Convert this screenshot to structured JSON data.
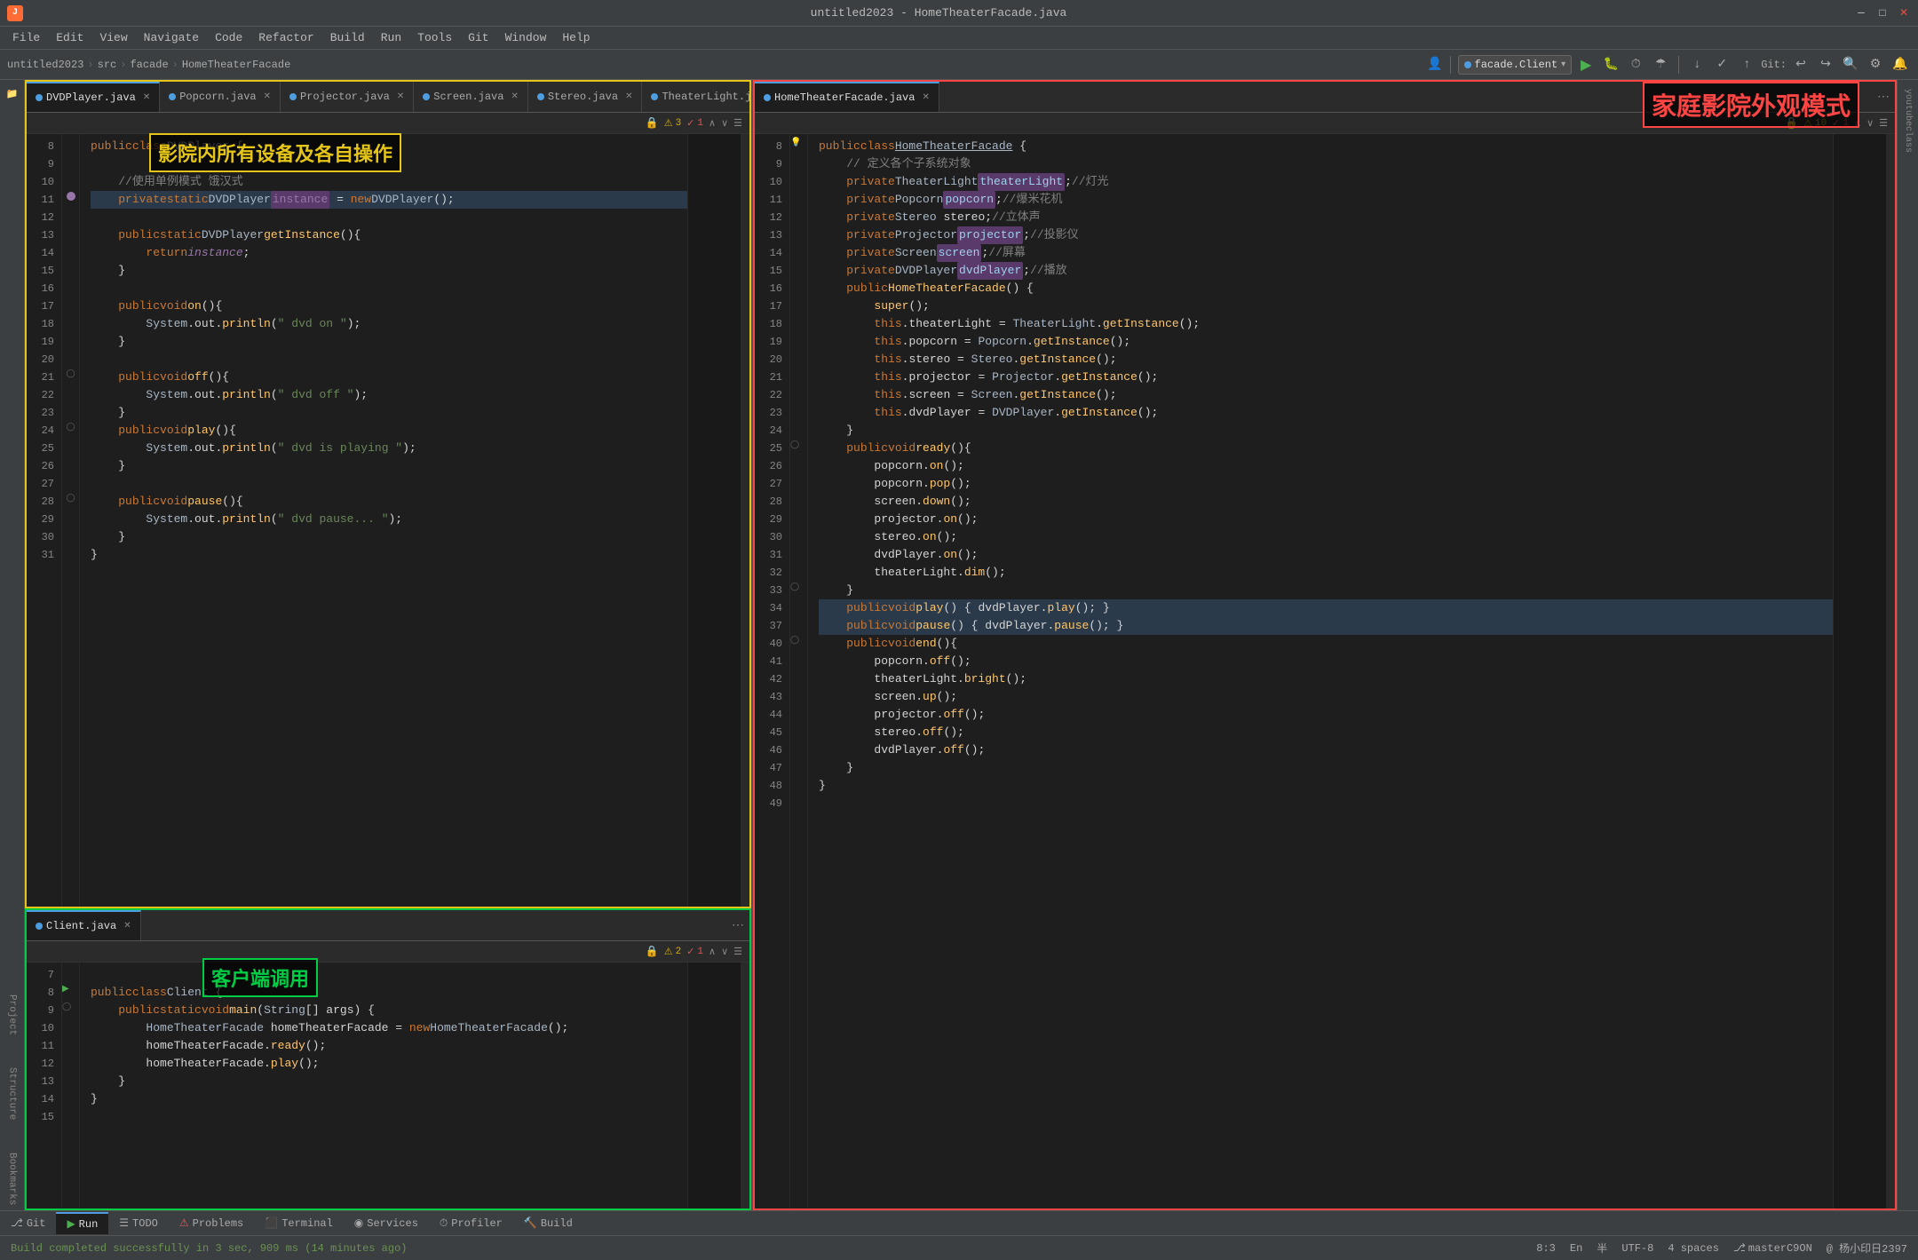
{
  "window": {
    "title": "untitled2023 - HomeTheaterFacade.java",
    "app_name": "IntelliJ IDEA"
  },
  "menu": {
    "items": [
      "File",
      "Edit",
      "View",
      "Navigate",
      "Code",
      "Refactor",
      "Build",
      "Run",
      "Tools",
      "Git",
      "Window",
      "Help"
    ]
  },
  "breadcrumb": {
    "items": [
      "untitled2023",
      "src",
      "facade",
      "HomeTheaterFacade"
    ]
  },
  "toolbar": {
    "run_config": "facade.Client",
    "git_branch": "masterC9ON"
  },
  "tabs_left": {
    "items": [
      {
        "label": "DVDPlayer.java",
        "color": "#4e9de0",
        "active": true
      },
      {
        "label": "Popcorn.java",
        "color": "#4e9de0",
        "active": false
      },
      {
        "label": "Projector.java",
        "color": "#4e9de0",
        "active": false
      },
      {
        "label": "Screen.java",
        "color": "#4e9de0",
        "active": false
      },
      {
        "label": "Stereo.java",
        "color": "#4e9de0",
        "active": false
      },
      {
        "label": "TheaterLight.java",
        "color": "#4e9de0",
        "active": false
      }
    ]
  },
  "tabs_right": {
    "items": [
      {
        "label": "HomeTheaterFacade.java",
        "color": "#4e9de0",
        "active": true
      }
    ]
  },
  "tab_bottom": {
    "items": [
      {
        "label": "Client.java",
        "color": "#4e9de0",
        "active": true
      }
    ]
  },
  "annotations": {
    "yellow": "影院内所有设备及各自操作",
    "red": "家庭影院外观模式",
    "green": "客户端调用"
  },
  "bottom_tabs": {
    "items": [
      "Git",
      "Run",
      "TODO",
      "Problems",
      "Terminal",
      "Services",
      "Profiler",
      "Build"
    ]
  },
  "status_bar": {
    "message": "Build completed successfully in 3 sec, 909 ms (14 minutes ago)",
    "position": "8:3",
    "encoding": "UTF-8",
    "indent": "4 spaces",
    "branch": "masterC9ON",
    "user": "@ 杨小印日2397"
  },
  "dvdplayer_code": [
    {
      "ln": "8",
      "text": "public class DVDPlayer {"
    },
    {
      "ln": "9",
      "text": ""
    },
    {
      "ln": "10",
      "text": "    //使用单例模式 饿汉式"
    },
    {
      "ln": "11",
      "text": "    private static DVDPlayer instance = new DVDPlayer();"
    },
    {
      "ln": "12",
      "text": ""
    },
    {
      "ln": "13",
      "text": "    public static DVDPlayer getInstance(){"
    },
    {
      "ln": "14",
      "text": "        return instance;"
    },
    {
      "ln": "15",
      "text": "    }"
    },
    {
      "ln": "16",
      "text": ""
    },
    {
      "ln": "17",
      "text": "    public void on(){"
    },
    {
      "ln": "18",
      "text": "        System.out.println(\" dvd on \");"
    },
    {
      "ln": "19",
      "text": "    }"
    },
    {
      "ln": "20",
      "text": ""
    },
    {
      "ln": "21",
      "text": "    public void off(){"
    },
    {
      "ln": "22",
      "text": "        System.out.println(\" dvd off \");"
    },
    {
      "ln": "23",
      "text": "    }"
    },
    {
      "ln": "24",
      "text": "    public void play(){"
    },
    {
      "ln": "25",
      "text": "        System.out.println(\" dvd is playing \");"
    },
    {
      "ln": "26",
      "text": "    }"
    },
    {
      "ln": "27",
      "text": ""
    },
    {
      "ln": "28",
      "text": "    public void pause(){"
    },
    {
      "ln": "29",
      "text": "        System.out.println(\" dvd pause... \");"
    },
    {
      "ln": "30",
      "text": "    }"
    },
    {
      "ln": "31",
      "text": "}"
    }
  ],
  "facade_code": [
    {
      "ln": "8",
      "text": "public class HomeTheaterFacade {"
    },
    {
      "ln": "9",
      "text": "    // 定义各个子系统对象"
    },
    {
      "ln": "10",
      "text": "    private TheaterLight theaterLight;//灯光"
    },
    {
      "ln": "11",
      "text": "    private Popcorn popcorn;//爆米花机"
    },
    {
      "ln": "12",
      "text": "    private Stereo stereo;//立体声"
    },
    {
      "ln": "13",
      "text": "    private Projector projector;//投影仪"
    },
    {
      "ln": "14",
      "text": "    private Screen screen;//屏幕"
    },
    {
      "ln": "15",
      "text": "    private DVDPlayer dvdPlayer;//播放"
    },
    {
      "ln": "16",
      "text": "    public HomeTheaterFacade() {"
    },
    {
      "ln": "17",
      "text": "        super();"
    },
    {
      "ln": "18",
      "text": "        this.theaterLight = TheaterLight.getInstance();"
    },
    {
      "ln": "19",
      "text": "        this.popcorn = Popcorn.getInstance();"
    },
    {
      "ln": "20",
      "text": "        this.stereo = Stereo.getInstance();"
    },
    {
      "ln": "21",
      "text": "        this.projector = Projector.getInstance();"
    },
    {
      "ln": "22",
      "text": "        this.screen = Screen.getInstance();"
    },
    {
      "ln": "23",
      "text": "        this.dvdPlayer = DVDPlayer.getInstance();"
    },
    {
      "ln": "24",
      "text": "    }"
    },
    {
      "ln": "25",
      "text": "    public void ready(){"
    },
    {
      "ln": "26",
      "text": "        popcorn.on();"
    },
    {
      "ln": "27",
      "text": "        popcorn.pop();"
    },
    {
      "ln": "28",
      "text": "        screen.down();"
    },
    {
      "ln": "29",
      "text": "        projector.on();"
    },
    {
      "ln": "30",
      "text": "        stereo.on();"
    },
    {
      "ln": "31",
      "text": "        dvdPlayer.on();"
    },
    {
      "ln": "32",
      "text": "        theaterLight.dim();"
    },
    {
      "ln": "33",
      "text": "    }"
    },
    {
      "ln": "34",
      "text": "    public void play() { dvdPlayer.play(); }"
    },
    {
      "ln": "37",
      "text": "    public void pause() { dvdPlayer.pause(); }"
    },
    {
      "ln": "40",
      "text": "    public void end(){"
    },
    {
      "ln": "41",
      "text": "        popcorn.off();"
    },
    {
      "ln": "42",
      "text": "        theaterLight.bright();"
    },
    {
      "ln": "43",
      "text": "        screen.up();"
    },
    {
      "ln": "44",
      "text": "        projector.off();"
    },
    {
      "ln": "45",
      "text": "        stereo.off();"
    },
    {
      "ln": "46",
      "text": "        dvdPlayer.off();"
    },
    {
      "ln": "47",
      "text": "    }"
    },
    {
      "ln": "48",
      "text": "}"
    },
    {
      "ln": "49",
      "text": ""
    }
  ],
  "client_code": [
    {
      "ln": "7",
      "text": ""
    },
    {
      "ln": "8",
      "text": "public class Client {"
    },
    {
      "ln": "9",
      "text": "    public static void main(String[] args) {"
    },
    {
      "ln": "10",
      "text": "        HomeTheaterFacade homeTheaterFacade = new HomeTheaterFacade();"
    },
    {
      "ln": "11",
      "text": "        homeTheaterFacade.ready();"
    },
    {
      "ln": "12",
      "text": "        homeTheaterFacade.play();"
    },
    {
      "ln": "13",
      "text": "    }"
    },
    {
      "ln": "14",
      "text": "}"
    },
    {
      "ln": "15",
      "text": ""
    }
  ]
}
